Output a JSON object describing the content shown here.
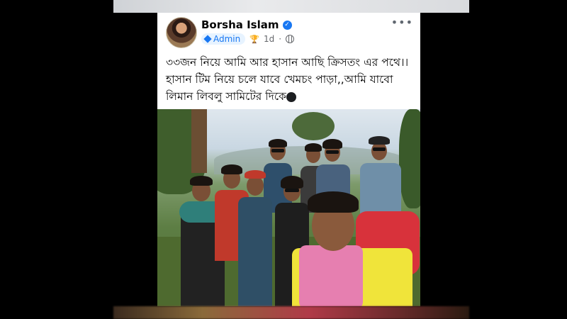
{
  "post": {
    "author": "Borsha Islam",
    "role_badge": "Admin",
    "time": "1d",
    "more_label": "•••",
    "text": "৩৩জন নিয়ে আমি আর হাসান আছি ক্রিসতং এর পথে।।হাসান টিম নিয়ে চলে যাবে খেমচং পাড়া,,আমি যাবো লিমান লিবলু সামিটের দিকে"
  },
  "icons": {
    "verified": "verified-check-icon",
    "admin": "admin-diamond-icon",
    "trophy": "trophy-icon",
    "audience": "globe-icon",
    "heart": "black-heart-icon"
  },
  "colors": {
    "accent": "#1877f2",
    "card_bg": "#ffffff",
    "frame_bg": "#000000"
  }
}
